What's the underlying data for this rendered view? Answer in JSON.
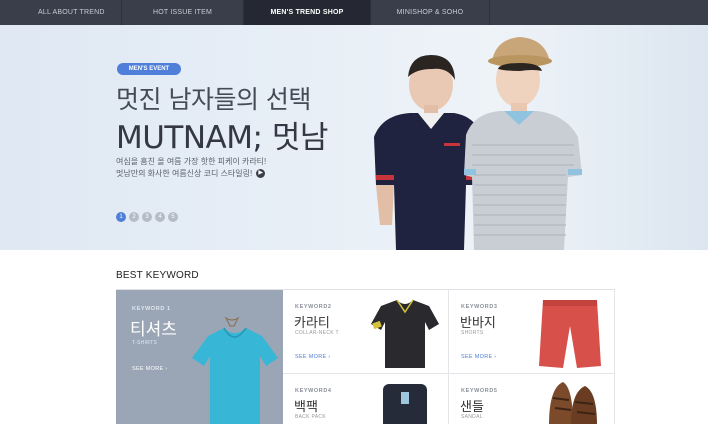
{
  "nav": {
    "tabs": [
      {
        "label": "ALL ABOUT TREND"
      },
      {
        "label": "HOT ISSUE ITEM"
      },
      {
        "label": "MEN'S TREND SHOP"
      },
      {
        "label": "MINISHOP & SOHO"
      }
    ],
    "active_index": 2
  },
  "hero": {
    "badge": "MEN'S EVENT",
    "title_kr": "멋진 남자들의 선택",
    "title_en": "MUTNAM; 멋남",
    "desc_line1": "여심을 훔친 올 여름 가장 핫한 피케이 카라티!",
    "desc_line2": "멋남만의 화사한 여름신상 코디 스타일링!",
    "arrow_icon": "arrow-right-icon",
    "pages": [
      "1",
      "2",
      "3",
      "4",
      "5"
    ],
    "active_page": 0,
    "accent_color": "#4f7fd9"
  },
  "best": {
    "title": "BEST KEYWORD",
    "main": {
      "label": "KEYWORD 1",
      "name": "티셔츠",
      "sub": "T-SHIRTS",
      "more": "SEE MORE"
    },
    "items": [
      {
        "label": "KEYWORD2",
        "name": "카라티",
        "sub": "COLLAR-NECK T",
        "more": "SEE MORE"
      },
      {
        "label": "KEYWORD3",
        "name": "반바지",
        "sub": "SHORTS",
        "more": "SEE MORE"
      },
      {
        "label": "KEYWORD4",
        "name": "백팩",
        "sub": "BACK PACK",
        "more": ""
      },
      {
        "label": "KEYWORD5",
        "name": "샌들",
        "sub": "SANDAL",
        "more": ""
      }
    ]
  }
}
